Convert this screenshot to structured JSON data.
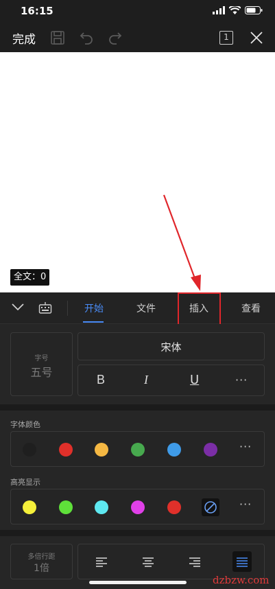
{
  "status_bar": {
    "time": "16:15",
    "icons": [
      "signal-icon",
      "wifi-icon",
      "battery-icon"
    ]
  },
  "toolbar": {
    "done_label": "完成",
    "page_count": "1",
    "icons": [
      "save-icon",
      "undo-icon",
      "redo-icon",
      "page-count-icon",
      "close-icon"
    ]
  },
  "document": {
    "word_count": "全文：0"
  },
  "tabs": {
    "collapse_icon": "chevron-down-icon",
    "keyboard_icon": "keyboard-icon",
    "items": [
      {
        "label": "开始",
        "active": true
      },
      {
        "label": "文件",
        "active": false
      },
      {
        "label": "插入",
        "active": false
      },
      {
        "label": "查看",
        "active": false
      }
    ]
  },
  "font": {
    "size_label": "字号",
    "size_value": "五号",
    "name": "宋体",
    "styles": [
      "B",
      "I",
      "U"
    ],
    "more": "···"
  },
  "font_color": {
    "label": "字体颜色",
    "colors": [
      "#1f1f1f",
      "#e0302a",
      "#f5b843",
      "#47a94e",
      "#3f9be8",
      "#7b2ea6"
    ],
    "more": "···"
  },
  "highlight": {
    "label": "高亮显示",
    "colors": [
      "#f5f03a",
      "#5fe03a",
      "#5ee8f0",
      "#e040e8",
      "#e0302a"
    ],
    "none_icon": "no-color-icon",
    "more": "···"
  },
  "paragraph": {
    "spacing_label": "多倍行距",
    "spacing_value": "1倍",
    "alignments": [
      "align-left-icon",
      "align-center-icon",
      "align-right-icon",
      "align-justify-icon"
    ],
    "active_alignment": "align-justify-icon"
  },
  "watermark": "dzbzw.com",
  "accent_color": "#4a8cf7",
  "annotation_color": "#e0262b"
}
